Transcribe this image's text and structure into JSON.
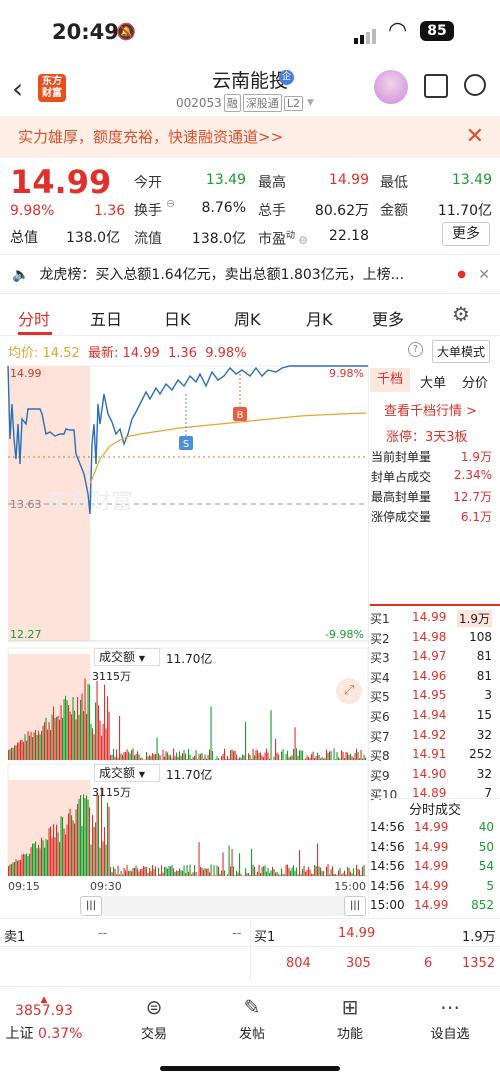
{
  "status": {
    "time": "20:49",
    "battery": "85"
  },
  "header": {
    "stock_name": "云南能投",
    "stock_code": "002053",
    "tags": [
      "融",
      "深股通",
      "L2"
    ],
    "logo_text": "东方财富"
  },
  "promo": {
    "text": "实力雄厚，额度充裕，快速融资通道>>"
  },
  "quote": {
    "price": "14.99",
    "pct": "9.98%",
    "change": "1.36",
    "total_cap_label": "总值",
    "total_cap": "138.0亿",
    "labels": {
      "open": "今开",
      "high": "最高",
      "low": "最低",
      "turnover": "换手",
      "vol": "总手",
      "amount": "金额",
      "float": "流值",
      "pe": "市盈",
      "pe_sup": "动"
    },
    "open": "13.49",
    "high": "14.99",
    "low": "13.49",
    "turnover": "8.76%",
    "vol": "80.62万",
    "amount": "11.70亿",
    "float": "138.0亿",
    "pe": "22.18",
    "more": "更多"
  },
  "lhb": {
    "text": "龙虎榜：买入总额1.64亿元，卖出总额1.803亿元，上榜..."
  },
  "tabs": [
    "分时",
    "五日",
    "日K",
    "周K",
    "月K",
    "更多"
  ],
  "avg": {
    "label_avg": "均价:",
    "avg": "14.52",
    "label_latest": "最新:",
    "latest": "14.99",
    "chg": "1.36",
    "pct": "9.98%",
    "big_order": "大单模式"
  },
  "chart": {
    "y_top": "14.99",
    "y_mid": "13.63",
    "y_bot": "12.27",
    "pct_top": "9.98%",
    "pct_bot": "-9.98%",
    "vol_label": "成交额",
    "vol_value": "11.70亿",
    "vol_max": "3115万",
    "x_start": "09:15",
    "x_mid": "09:30",
    "x_end": "15:00",
    "marker_s": "S",
    "marker_b": "B",
    "watermark": "东方财富"
  },
  "right_panel": {
    "tabs": [
      "千档",
      "大单",
      "分价"
    ],
    "view_link": "查看千档行情 >",
    "limit_up": "涨停：3天3板",
    "rows": [
      {
        "label": "当前封单量",
        "value": "1.9万"
      },
      {
        "label": "封单占成交",
        "value": "2.34%"
      },
      {
        "label": "最高封单量",
        "value": "12.7万"
      },
      {
        "label": "涨停成交量",
        "value": "6.1万"
      }
    ],
    "bids": [
      {
        "label": "买1",
        "price": "14.99",
        "vol": "1.9万"
      },
      {
        "label": "买2",
        "price": "14.98",
        "vol": "108"
      },
      {
        "label": "买3",
        "price": "14.97",
        "vol": "81"
      },
      {
        "label": "买4",
        "price": "14.96",
        "vol": "81"
      },
      {
        "label": "买5",
        "price": "14.95",
        "vol": "3"
      },
      {
        "label": "买6",
        "price": "14.94",
        "vol": "15"
      },
      {
        "label": "买7",
        "price": "14.92",
        "vol": "32"
      },
      {
        "label": "买8",
        "price": "14.91",
        "vol": "252"
      },
      {
        "label": "买9",
        "price": "14.90",
        "vol": "32"
      },
      {
        "label": "买10",
        "price": "14.89",
        "vol": "7"
      }
    ],
    "ticks_title": "分时成交",
    "ticks": [
      {
        "time": "14:56",
        "price": "14.99",
        "vol": "40"
      },
      {
        "time": "14:56",
        "price": "14.99",
        "vol": "50"
      },
      {
        "time": "14:56",
        "price": "14.99",
        "vol": "54"
      },
      {
        "time": "14:56",
        "price": "14.99",
        "vol": "5"
      },
      {
        "time": "15:00",
        "price": "14.99",
        "vol": "852"
      }
    ]
  },
  "bottom_quotes": {
    "sell1_label": "卖1",
    "sell1_price": "--",
    "sell1_vol": "--",
    "buy1_label": "买1",
    "buy1_price": "14.99",
    "buy1_vol": "1.9万",
    "vols": [
      "804",
      "305",
      "6",
      "1352"
    ]
  },
  "nav": {
    "index_value": "3857.93",
    "index_name": "上证",
    "index_pct": "0.37%",
    "items": [
      "交易",
      "发帖",
      "功能",
      "设自选"
    ]
  }
}
